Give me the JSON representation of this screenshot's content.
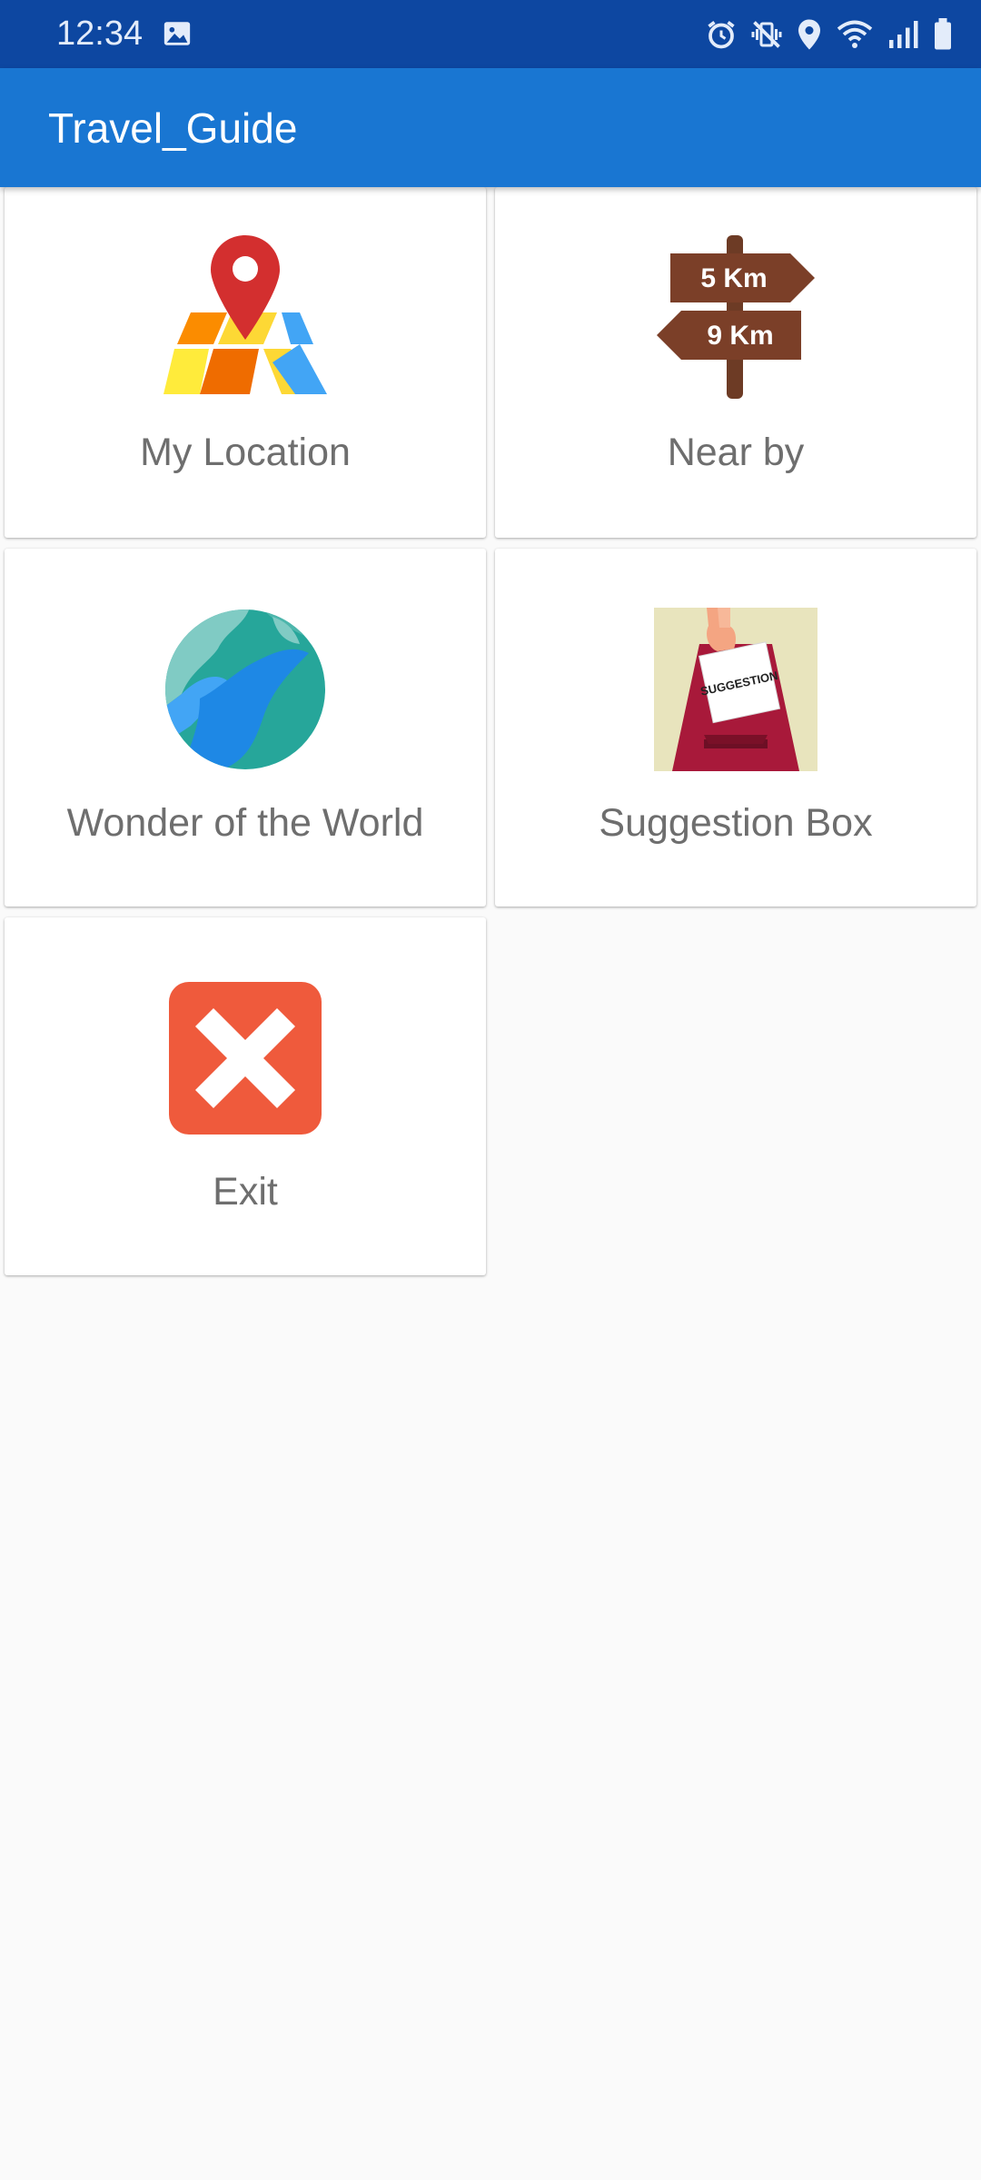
{
  "status_bar": {
    "time": "12:34",
    "icons": [
      "image-icon",
      "alarm-icon",
      "vibrate-mute-icon",
      "location-icon",
      "wifi-icon",
      "signal-icon",
      "battery-icon"
    ]
  },
  "app_bar": {
    "title": "Travel_Guide",
    "color": "#1976d2"
  },
  "menu": {
    "items": [
      {
        "label": "My Location",
        "icon": "map-pin-icon"
      },
      {
        "label": "Near by",
        "icon": "signpost-icon",
        "sign_top": "5 Km",
        "sign_bottom": "9 Km"
      },
      {
        "label": "Wonder of the World",
        "icon": "globe-icon"
      },
      {
        "label": "Suggestion Box",
        "icon": "suggestion-box-icon",
        "paper_text": "SUGGESTION"
      },
      {
        "label": "Exit",
        "icon": "exit-icon"
      }
    ]
  },
  "colors": {
    "status_bar": "#0d47a1",
    "background": "#fafafa",
    "label_text": "#6e6e6e"
  }
}
